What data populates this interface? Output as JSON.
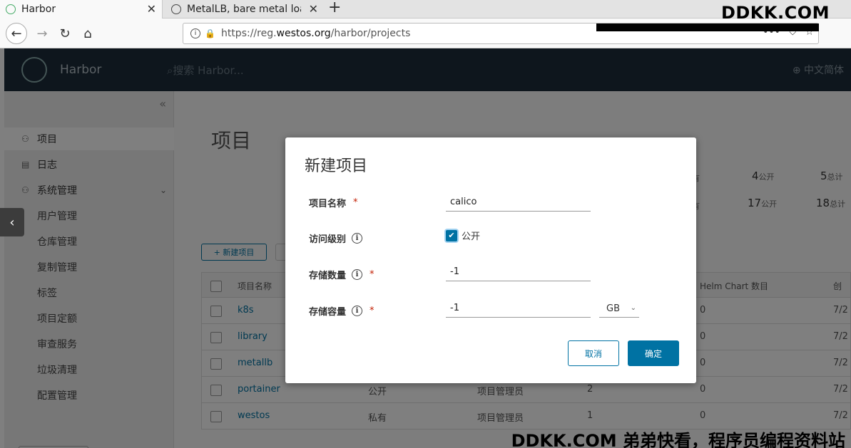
{
  "browser": {
    "tabs": [
      {
        "title": "Harbor",
        "active": true
      },
      {
        "title": "MetalLB, bare metal load-",
        "active": false
      }
    ],
    "url_prefix": "https://reg.",
    "url_domain": "westos.org",
    "url_path": "/harbor/projects"
  },
  "watermark": {
    "top": "DDKK.COM",
    "bottom": "DDKK.COM 弟弟快看，程序员编程资料站"
  },
  "app": {
    "title": "Harbor",
    "search_placeholder": "搜索 Harbor...",
    "language": "中文简体"
  },
  "sidebar": {
    "items": [
      {
        "label": "项目",
        "icon": "projects-icon"
      },
      {
        "label": "日志",
        "icon": "logs-icon"
      },
      {
        "label": "系统管理",
        "icon": "admin-icon"
      }
    ],
    "subitems": [
      {
        "label": "用户管理"
      },
      {
        "label": "仓库管理"
      },
      {
        "label": "复制管理"
      },
      {
        "label": "标签"
      },
      {
        "label": "项目定额"
      },
      {
        "label": "审查服务"
      },
      {
        "label": "垃圾清理"
      },
      {
        "label": "配置管理"
      }
    ]
  },
  "main": {
    "page_title": "项目",
    "stats": [
      {
        "value": "4",
        "label": "公开"
      },
      {
        "value": "5",
        "label": "总计"
      },
      {
        "value": "17",
        "label": "公开"
      },
      {
        "value": "18",
        "label": "总计"
      }
    ],
    "stat_fragments": [
      "有",
      "有"
    ],
    "new_project_label": "+ 新建项目",
    "table": {
      "headers": [
        "项目名称",
        "Helm Chart 数目",
        "创"
      ],
      "rows": [
        {
          "name": "k8s",
          "access": "",
          "role": "",
          "repos": "",
          "charts": "0",
          "created": "7/2"
        },
        {
          "name": "library",
          "access": "",
          "role": "",
          "repos": "",
          "charts": "0",
          "created": "7/2"
        },
        {
          "name": "metallb",
          "access": "",
          "role": "",
          "repos": "",
          "charts": "0",
          "created": "7/2"
        },
        {
          "name": "portainer",
          "access": "公开",
          "role": "项目管理员",
          "repos": "2",
          "charts": "0",
          "created": "7/2"
        },
        {
          "name": "westos",
          "access": "私有",
          "role": "项目管理员",
          "repos": "1",
          "charts": "0",
          "created": "7/2"
        }
      ]
    }
  },
  "modal": {
    "title": "新建项目",
    "fields": {
      "name_label": "项目名称",
      "name_value": "calico",
      "access_label": "访问级别",
      "public_label": "公开",
      "count_label": "存储数量",
      "count_value": "-1",
      "capacity_label": "存储容量",
      "capacity_value": "-1",
      "unit": "GB"
    },
    "required_mark": "*",
    "cancel_label": "取消",
    "ok_label": "确定"
  }
}
